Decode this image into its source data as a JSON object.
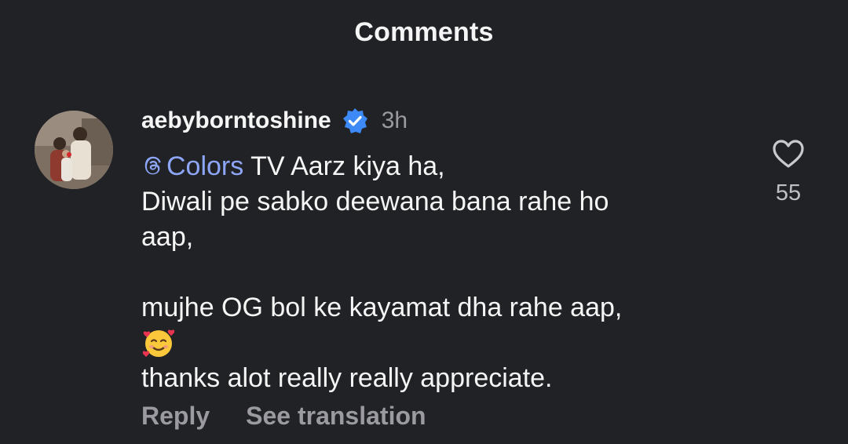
{
  "header": {
    "title": "Comments"
  },
  "comment": {
    "avatar_icon": "user-avatar-photo",
    "username": "aebyborntoshine",
    "verified_icon": "verified-badge-icon",
    "timestamp": "3h",
    "mention": "Colors",
    "lines": [
      " TV Aarz kiya ha,",
      "Diwali pe sabko deewana bana rahe ho",
      "aap,",
      "",
      "mujhe OG bol ke kayamat dha rahe aap,",
      "",
      "thanks alot really really appreciate."
    ],
    "emoji": "smiling-face-with-hearts",
    "like_icon": "heart-outline-icon",
    "like_count": "55",
    "actions": {
      "reply": "Reply",
      "see_translation": "See translation"
    }
  },
  "colors": {
    "background": "#212226",
    "text": "#f5f5f5",
    "muted": "#9a9aa0",
    "mention": "#8da6f8",
    "verified": "#3d8af7"
  }
}
